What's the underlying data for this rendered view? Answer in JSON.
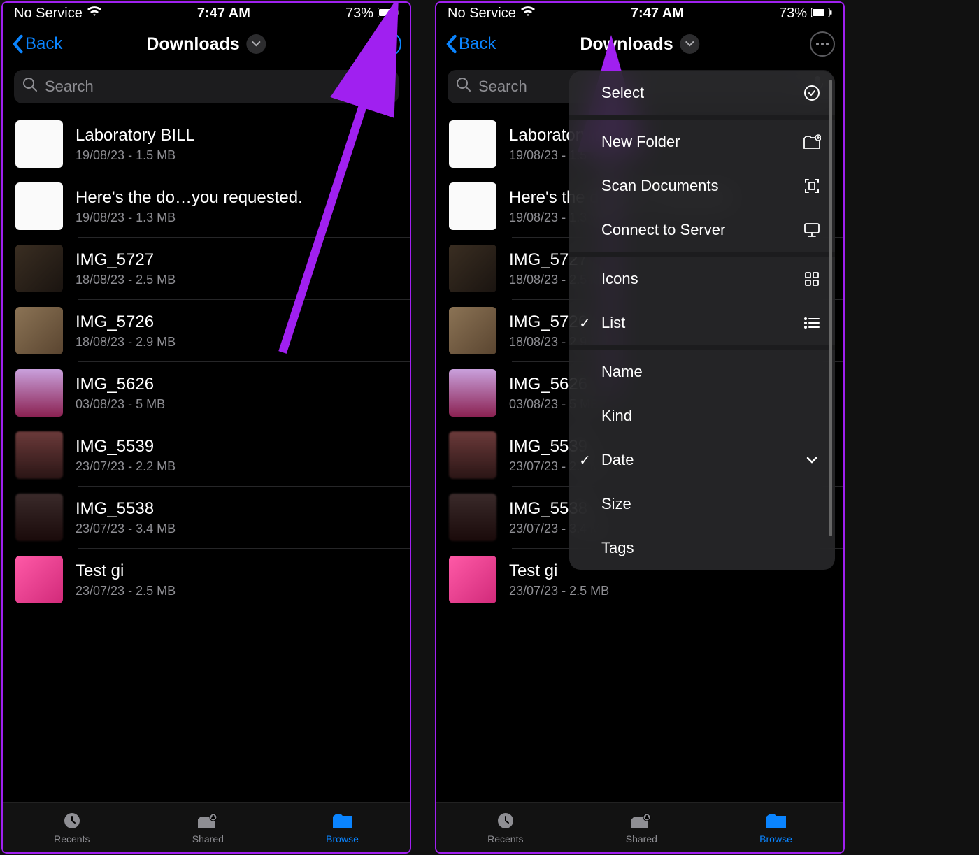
{
  "status": {
    "carrier": "No Service",
    "time": "7:47 AM",
    "battery_pct": "73%"
  },
  "nav": {
    "back": "Back",
    "title": "Downloads"
  },
  "search": {
    "placeholder": "Search"
  },
  "files": [
    {
      "name": "Laboratory BILL",
      "sub": "19/08/23 - 1.5 MB",
      "thumb": "doc"
    },
    {
      "name": "Here's the do…you requested.",
      "sub": "19/08/23 - 1.3 MB",
      "thumb": "doc"
    },
    {
      "name": "IMG_5727",
      "sub": "18/08/23 - 2.5 MB",
      "thumb": "photo1"
    },
    {
      "name": "IMG_5726",
      "sub": "18/08/23 - 2.9 MB",
      "thumb": "photo2"
    },
    {
      "name": "IMG_5626",
      "sub": "03/08/23 - 5 MB",
      "thumb": "photo3"
    },
    {
      "name": "IMG_5539",
      "sub": "23/07/23 - 2.2 MB",
      "thumb": "blur1"
    },
    {
      "name": "IMG_5538",
      "sub": "23/07/23 - 3.4 MB",
      "thumb": "blur2"
    },
    {
      "name": "Test gi",
      "sub": "23/07/23 - 2.5 MB",
      "thumb": "pink"
    }
  ],
  "tabs": {
    "recents": "Recents",
    "shared": "Shared",
    "browse": "Browse"
  },
  "menu": {
    "select": "Select",
    "new_folder": "New Folder",
    "scan": "Scan Documents",
    "connect": "Connect to Server",
    "icons": "Icons",
    "list": "List",
    "name": "Name",
    "kind": "Kind",
    "date": "Date",
    "size": "Size",
    "tags": "Tags"
  },
  "colors": {
    "accent": "#0a84ff",
    "annotation": "#a020f0"
  }
}
